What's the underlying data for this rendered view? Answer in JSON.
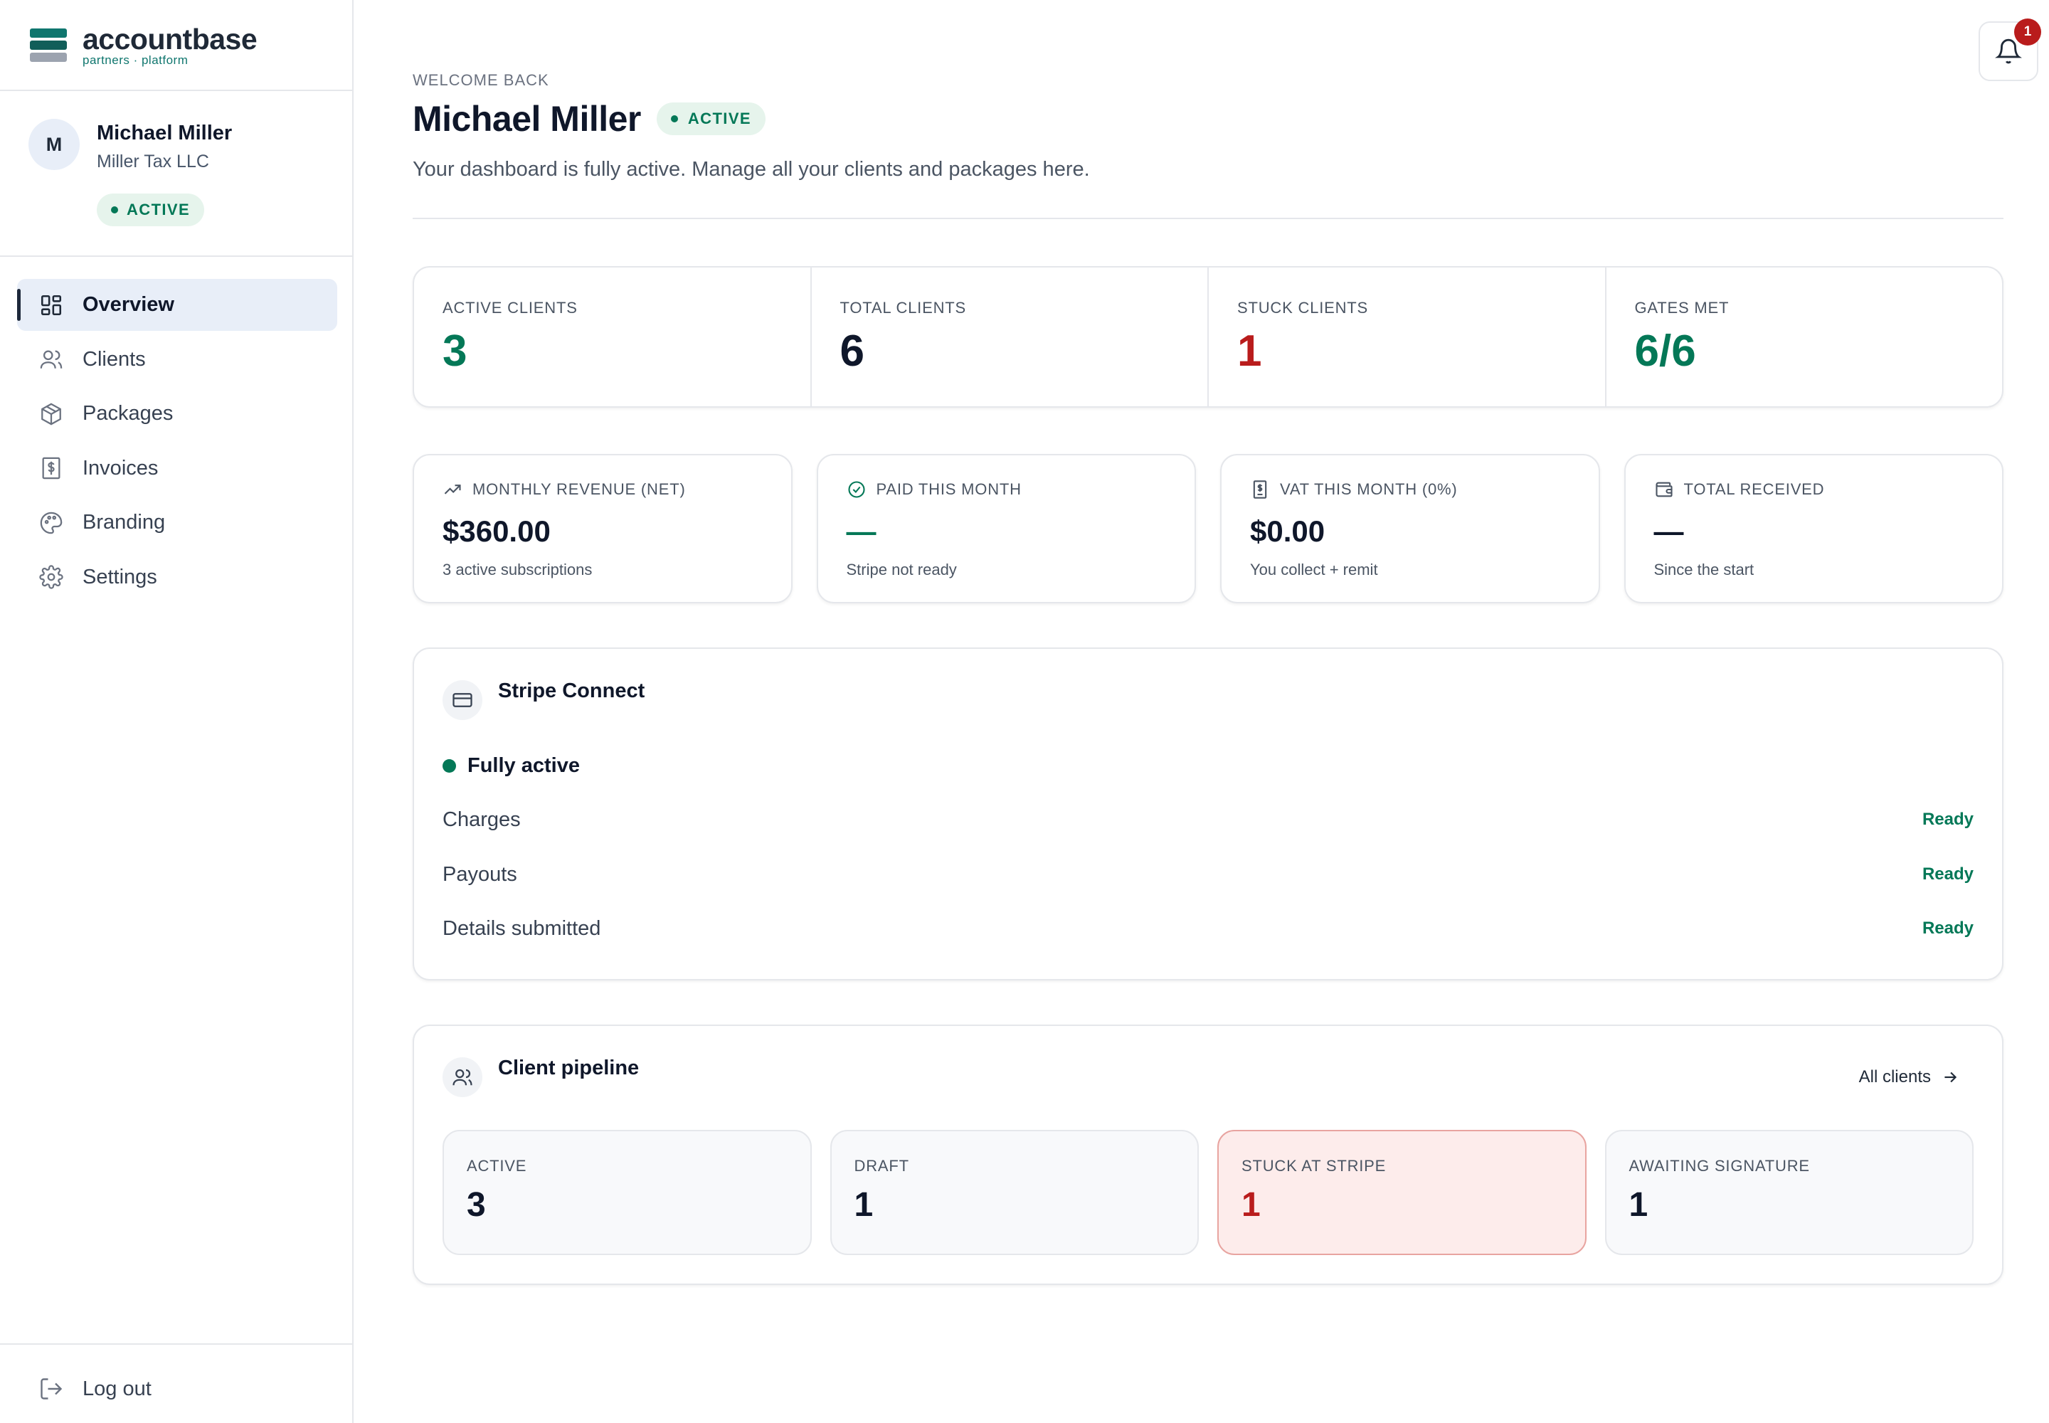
{
  "brand": {
    "name": "accountbase",
    "tagline": "partners · platform"
  },
  "profile": {
    "initial": "M",
    "name": "Michael Miller",
    "company": "Miller Tax LLC",
    "status": "ACTIVE"
  },
  "nav": {
    "items": [
      {
        "label": "Overview",
        "icon": "grid-icon",
        "active": true
      },
      {
        "label": "Clients",
        "icon": "users-icon"
      },
      {
        "label": "Packages",
        "icon": "package-icon"
      },
      {
        "label": "Invoices",
        "icon": "dollar-receipt-icon"
      },
      {
        "label": "Branding",
        "icon": "palette-icon"
      },
      {
        "label": "Settings",
        "icon": "gear-icon"
      }
    ],
    "logout": "Log out"
  },
  "header": {
    "eyebrow": "WELCOME BACK",
    "name": "Michael Miller",
    "status": "ACTIVE",
    "subtitle": "Your dashboard is fully active. Manage all your clients and packages here.",
    "notifications": "1"
  },
  "stats": [
    {
      "label": "ACTIVE CLIENTS",
      "value": "3",
      "color": "#047857"
    },
    {
      "label": "TOTAL CLIENTS",
      "value": "6",
      "color": "#0f172a"
    },
    {
      "label": "STUCK CLIENTS",
      "value": "1",
      "color": "#b91c1c"
    },
    {
      "label": "GATES MET",
      "value": "6/6",
      "color": "#047857"
    }
  ],
  "money": [
    {
      "label": "MONTHLY REVENUE (NET)",
      "icon": "trending-up-icon",
      "value": "$360.00",
      "note": "3 active subscriptions"
    },
    {
      "label": "PAID THIS MONTH",
      "icon": "check-circle-icon",
      "value": "—",
      "note": "Stripe not ready"
    },
    {
      "label": "VAT THIS MONTH (0%)",
      "icon": "receipt-icon",
      "value": "$0.00",
      "note": "You collect + remit"
    },
    {
      "label": "TOTAL RECEIVED",
      "icon": "wallet-icon",
      "value": "—",
      "note": "Since the start"
    }
  ],
  "stripe": {
    "title": "Stripe Connect",
    "status": "Fully active",
    "rows": [
      {
        "label": "Charges",
        "value": "Ready"
      },
      {
        "label": "Payouts",
        "value": "Ready"
      },
      {
        "label": "Details submitted",
        "value": "Ready"
      }
    ]
  },
  "pipeline": {
    "title": "Client pipeline",
    "link": "All clients",
    "cards": [
      {
        "label": "ACTIVE",
        "value": "3"
      },
      {
        "label": "DRAFT",
        "value": "1"
      },
      {
        "label": "STUCK AT STRIPE",
        "value": "1"
      },
      {
        "label": "AWAITING SIGNATURE",
        "value": "1"
      }
    ]
  },
  "colors": {
    "accent": "#047857",
    "danger": "#b91c1c",
    "navActiveBg": "#e8eef8"
  }
}
